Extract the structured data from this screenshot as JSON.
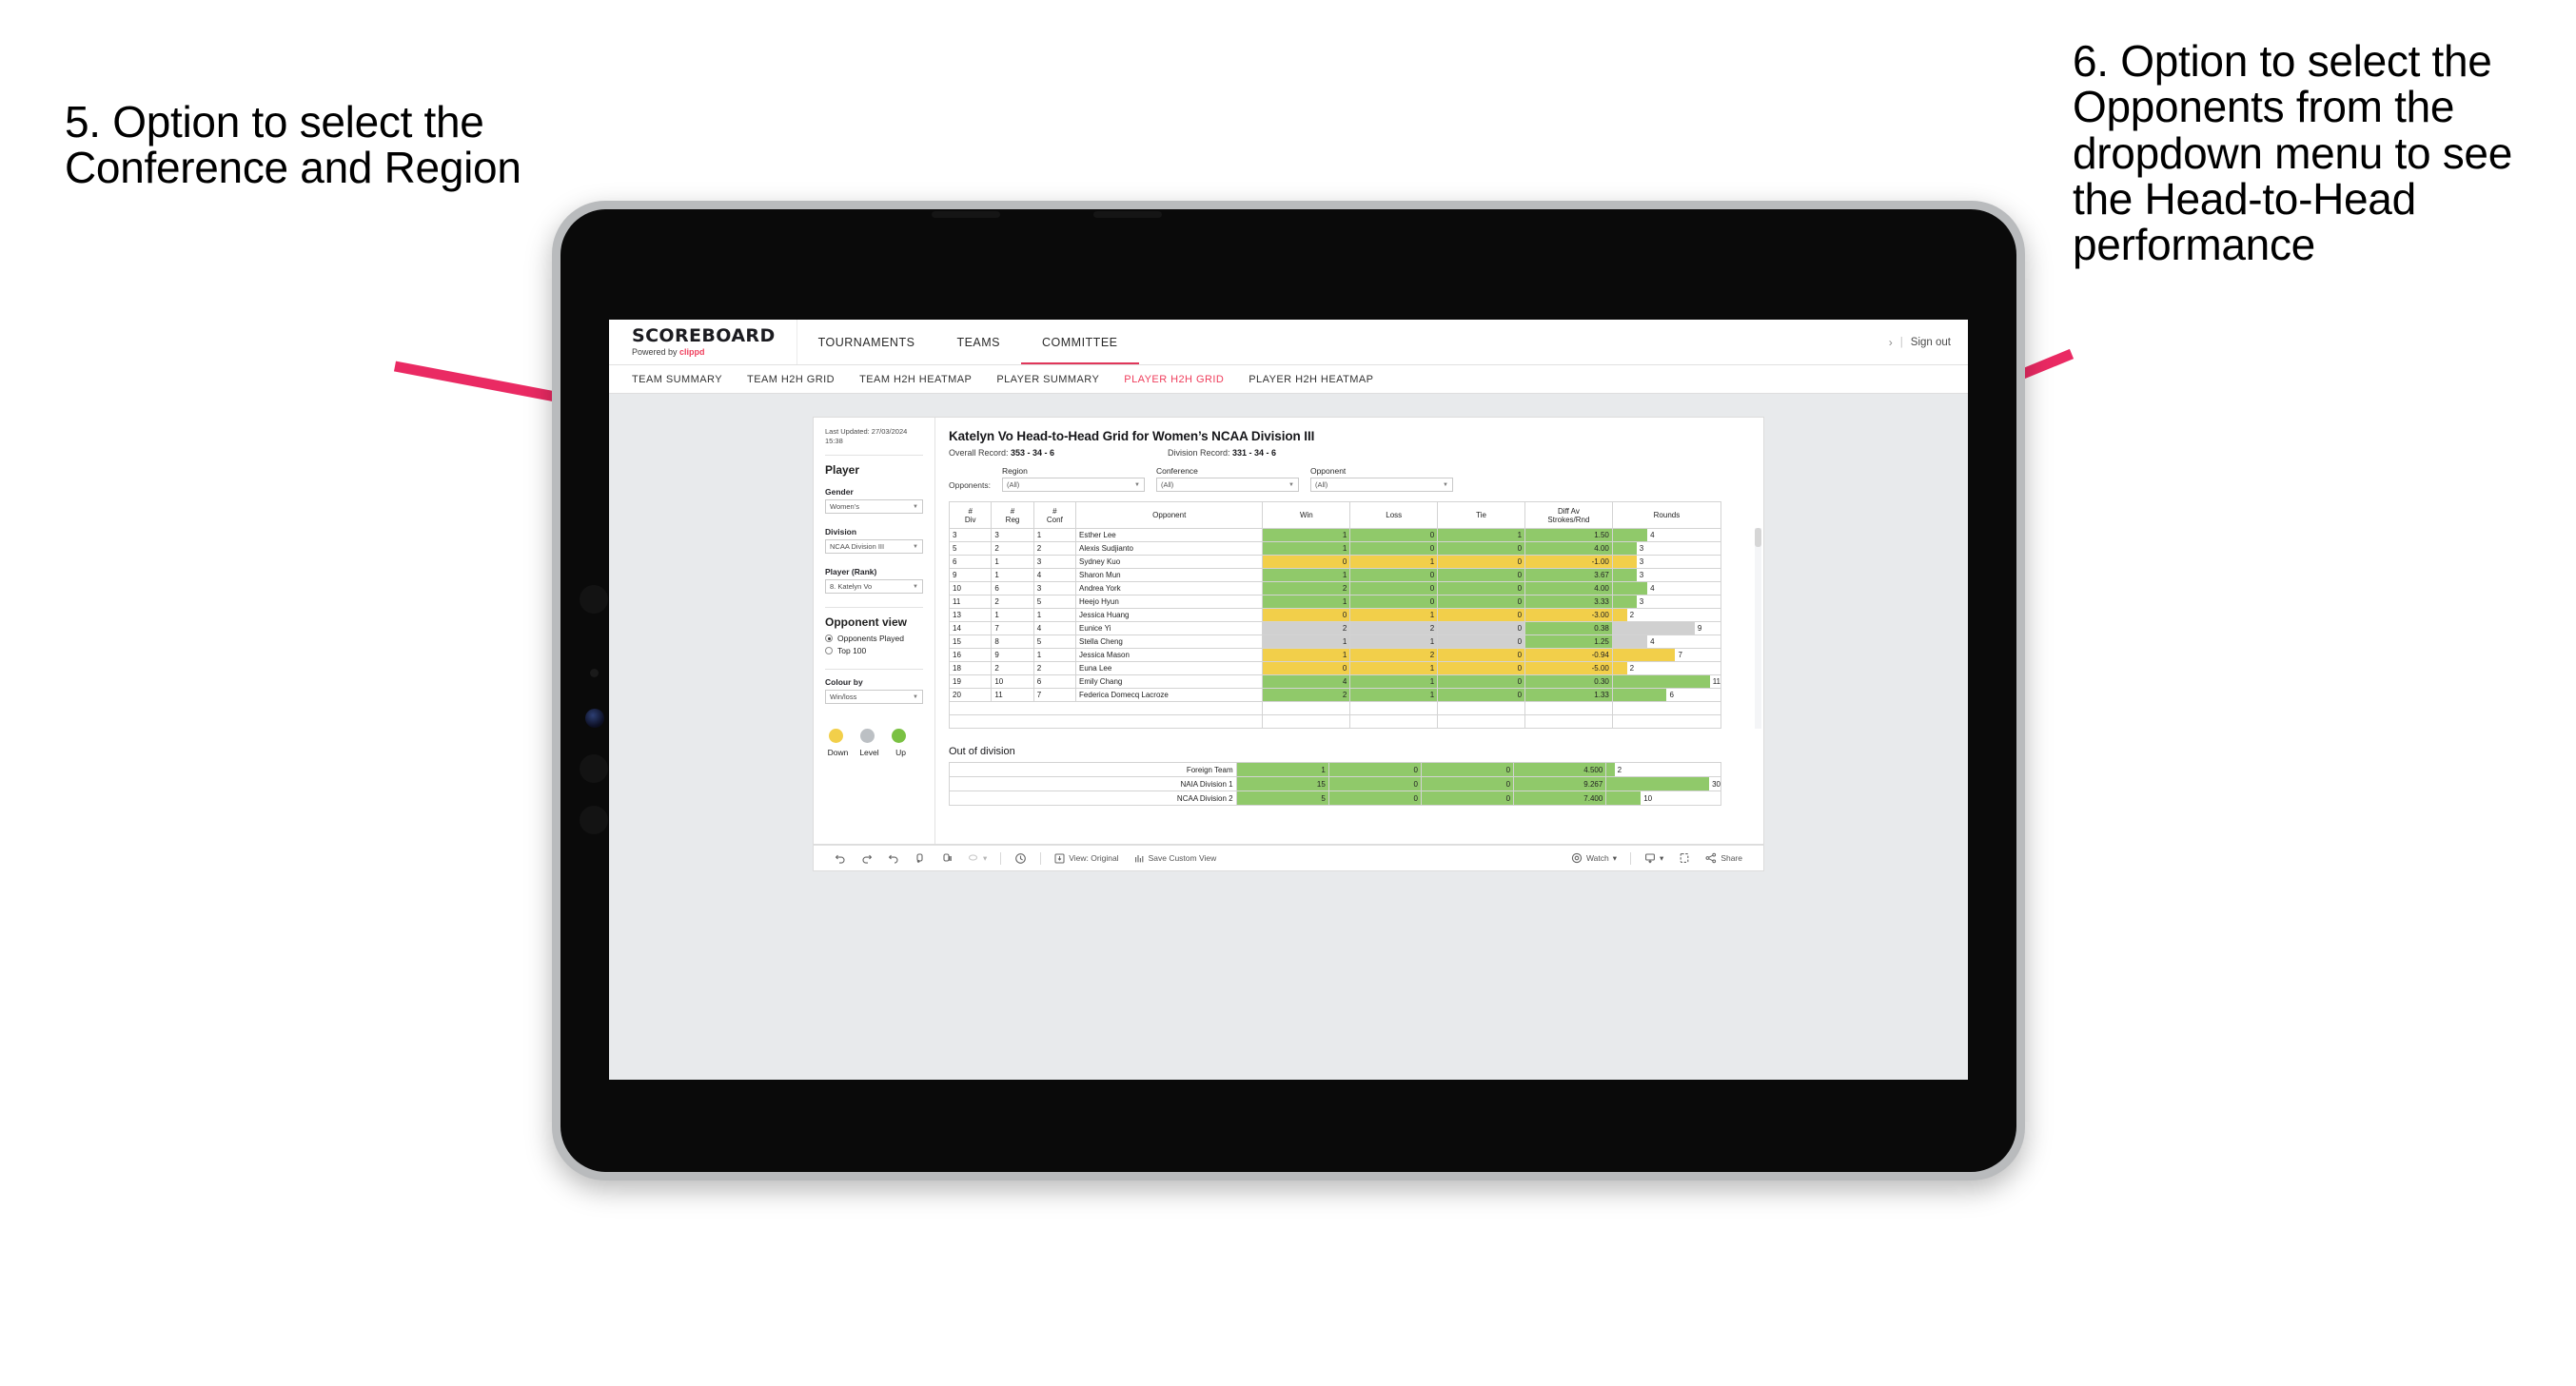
{
  "annotations": {
    "left": "5. Option to select the Conference and Region",
    "right": "6. Option to select the Opponents from the dropdown menu to see the Head-to-Head performance",
    "arrow_color": "#ea2a63"
  },
  "app": {
    "brand": {
      "title": "SCOREBOARD",
      "powered_prefix": "Powered by ",
      "powered_brand": "clippd"
    },
    "topnav": [
      {
        "label": "TOURNAMENTS",
        "active": false
      },
      {
        "label": "TEAMS",
        "active": false
      },
      {
        "label": "COMMITTEE",
        "active": true
      }
    ],
    "topbar_right": {
      "chevron": "›",
      "separator": "|",
      "sign_out": "Sign out"
    },
    "subnav": [
      {
        "label": "TEAM SUMMARY",
        "active": false
      },
      {
        "label": "TEAM H2H GRID",
        "active": false
      },
      {
        "label": "TEAM H2H HEATMAP",
        "active": false
      },
      {
        "label": "PLAYER SUMMARY",
        "active": false
      },
      {
        "label": "PLAYER H2H GRID",
        "active": true
      },
      {
        "label": "PLAYER H2H HEATMAP",
        "active": false
      }
    ],
    "accent_color": "#ef3e5c"
  },
  "sidebar": {
    "last_updated": "Last Updated: 27/03/2024 15:38",
    "section_title": "Player",
    "fields": [
      {
        "label": "Gender",
        "value": "Women’s"
      },
      {
        "label": "Division",
        "value": "NCAA Division III"
      },
      {
        "label": "Player (Rank)",
        "value": "8. Katelyn Vo"
      }
    ],
    "opponent_view": {
      "title": "Opponent view",
      "options": [
        {
          "label": "Opponents Played",
          "selected": true
        },
        {
          "label": "Top 100",
          "selected": false
        }
      ]
    },
    "colour_by": {
      "label": "Colour by",
      "value": "Win/loss"
    },
    "legend": [
      {
        "label": "Down",
        "color": "#f2cf4a"
      },
      {
        "label": "Level",
        "color": "#bcc0c4"
      },
      {
        "label": "Up",
        "color": "#7ac143"
      }
    ]
  },
  "viz": {
    "title": "Katelyn Vo Head-to-Head Grid for Women’s NCAA Division III",
    "overall_record_label": "Overall Record: ",
    "overall_record_value": "353 - 34 - 6",
    "division_record_label": "Division Record: ",
    "division_record_value": "331 - 34 - 6",
    "filters_lead": "Opponents:",
    "filters": [
      {
        "label": "Region",
        "value": "(All)"
      },
      {
        "label": "Conference",
        "value": "(All)"
      },
      {
        "label": "Opponent",
        "value": "(All)"
      }
    ],
    "columns": [
      "# Div",
      "# Reg",
      "# Conf",
      "Opponent",
      "Win",
      "Loss",
      "Tie",
      "Diff Av Strokes/Rnd",
      "Rounds"
    ],
    "columns_split": [
      {
        "l1": "#",
        "l2": "Div"
      },
      {
        "l1": "#",
        "l2": "Reg"
      },
      {
        "l1": "#",
        "l2": "Conf"
      },
      {
        "l1": "Opponent",
        "l2": ""
      },
      {
        "l1": "Win",
        "l2": ""
      },
      {
        "l1": "Loss",
        "l2": ""
      },
      {
        "l1": "Tie",
        "l2": ""
      },
      {
        "l1": "Diff Av",
        "l2": "Strokes/Rnd"
      },
      {
        "l1": "Rounds",
        "l2": ""
      }
    ],
    "rows": [
      {
        "div": "3",
        "reg": "3",
        "conf": "1",
        "opponent": "Esther Lee",
        "win": "1",
        "loss": "0",
        "tie": "1",
        "diff": "1.50",
        "rounds": "4",
        "color": "#90c96a",
        "bar_pct": 32
      },
      {
        "div": "5",
        "reg": "2",
        "conf": "2",
        "opponent": "Alexis Sudjianto",
        "win": "1",
        "loss": "0",
        "tie": "0",
        "diff": "4.00",
        "rounds": "3",
        "color": "#90c96a",
        "bar_pct": 22
      },
      {
        "div": "6",
        "reg": "1",
        "conf": "3",
        "opponent": "Sydney Kuo",
        "win": "0",
        "loss": "1",
        "tie": "0",
        "diff": "-1.00",
        "rounds": "3",
        "color": "#f2cf4a",
        "bar_pct": 22
      },
      {
        "div": "9",
        "reg": "1",
        "conf": "4",
        "opponent": "Sharon Mun",
        "win": "1",
        "loss": "0",
        "tie": "0",
        "diff": "3.67",
        "rounds": "3",
        "color": "#90c96a",
        "bar_pct": 22
      },
      {
        "div": "10",
        "reg": "6",
        "conf": "3",
        "opponent": "Andrea York",
        "win": "2",
        "loss": "0",
        "tie": "0",
        "diff": "4.00",
        "rounds": "4",
        "color": "#90c96a",
        "bar_pct": 32
      },
      {
        "div": "11",
        "reg": "2",
        "conf": "5",
        "opponent": "Heejo Hyun",
        "win": "1",
        "loss": "0",
        "tie": "0",
        "diff": "3.33",
        "rounds": "3",
        "color": "#90c96a",
        "bar_pct": 22
      },
      {
        "div": "13",
        "reg": "1",
        "conf": "1",
        "opponent": "Jessica Huang",
        "win": "0",
        "loss": "1",
        "tie": "0",
        "diff": "-3.00",
        "rounds": "2",
        "color": "#f2cf4a",
        "bar_pct": 13
      },
      {
        "div": "14",
        "reg": "7",
        "conf": "4",
        "opponent": "Eunice Yi",
        "win": "2",
        "loss": "2",
        "tie": "0",
        "diff": "0.38",
        "rounds": "9",
        "color": "#d0d0d0",
        "diff_color": "#90c96a",
        "bar_pct": 76
      },
      {
        "div": "15",
        "reg": "8",
        "conf": "5",
        "opponent": "Stella Cheng",
        "win": "1",
        "loss": "1",
        "tie": "0",
        "diff": "1.25",
        "rounds": "4",
        "color": "#d0d0d0",
        "diff_color": "#90c96a",
        "bar_pct": 32
      },
      {
        "div": "16",
        "reg": "9",
        "conf": "1",
        "opponent": "Jessica Mason",
        "win": "1",
        "loss": "2",
        "tie": "0",
        "diff": "-0.94",
        "rounds": "7",
        "color": "#f2cf4a",
        "bar_pct": 58
      },
      {
        "div": "18",
        "reg": "2",
        "conf": "2",
        "opponent": "Euna Lee",
        "win": "0",
        "loss": "1",
        "tie": "0",
        "diff": "-5.00",
        "rounds": "2",
        "color": "#f2cf4a",
        "bar_pct": 13
      },
      {
        "div": "19",
        "reg": "10",
        "conf": "6",
        "opponent": "Emily Chang",
        "win": "4",
        "loss": "1",
        "tie": "0",
        "diff": "0.30",
        "rounds": "11",
        "color": "#90c96a",
        "bar_pct": 92
      },
      {
        "div": "20",
        "reg": "11",
        "conf": "7",
        "opponent": "Federica Domecq Lacroze",
        "win": "2",
        "loss": "1",
        "tie": "0",
        "diff": "1.33",
        "rounds": "6",
        "color": "#90c96a",
        "bar_pct": 50
      }
    ],
    "out_of_division": {
      "title": "Out of division",
      "rows": [
        {
          "name": "Foreign Team",
          "win": "1",
          "loss": "0",
          "tie": "0",
          "diff": "4.500",
          "rounds": "2",
          "color": "#90c96a",
          "bar_pct": 7
        },
        {
          "name": "NAIA Division 1",
          "win": "15",
          "loss": "0",
          "tie": "0",
          "diff": "9.267",
          "rounds": "30",
          "color": "#90c96a",
          "bar_pct": 92
        },
        {
          "name": "NCAA Division 2",
          "win": "5",
          "loss": "0",
          "tie": "0",
          "diff": "7.400",
          "rounds": "10",
          "color": "#90c96a",
          "bar_pct": 30
        }
      ]
    }
  },
  "toolbar": {
    "view_original": "View: Original",
    "save_custom_view": "Save Custom View",
    "watch": "Watch",
    "share": "Share",
    "caret": "▾"
  }
}
